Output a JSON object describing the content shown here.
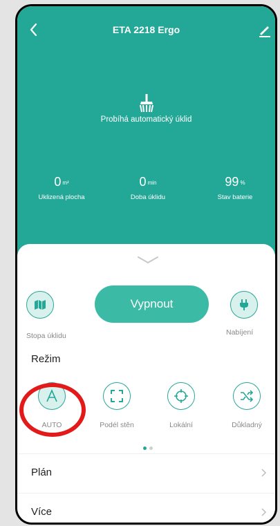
{
  "header": {
    "title": "ETA 2218 Ergo"
  },
  "status": {
    "text": "Probíhá automatický úklid"
  },
  "stats": [
    {
      "value": "0",
      "unit": "m²",
      "label": "Uklizená plocha"
    },
    {
      "value": "0",
      "unit": "min",
      "label": "Doba úklidu"
    },
    {
      "value": "99",
      "unit": "%",
      "label": "Stav baterie"
    }
  ],
  "controls": {
    "map_label": "Stopa úklidu",
    "main_button": "Vypnout",
    "charge_label": "Nabíjení"
  },
  "mode": {
    "title": "Režim",
    "items": [
      {
        "label": "AUTO",
        "icon": "auto-icon"
      },
      {
        "label": "Podél stěn",
        "icon": "edge-icon"
      },
      {
        "label": "Lokální",
        "icon": "spot-icon"
      },
      {
        "label": "Důkladný",
        "icon": "shuffle-icon"
      }
    ],
    "page": 1,
    "pages": 2
  },
  "menu": [
    {
      "label": "Plán"
    },
    {
      "label": "Více"
    }
  ],
  "colors": {
    "accent": "#23a796",
    "button": "#3bbba6",
    "highlight": "#e31a1a"
  }
}
